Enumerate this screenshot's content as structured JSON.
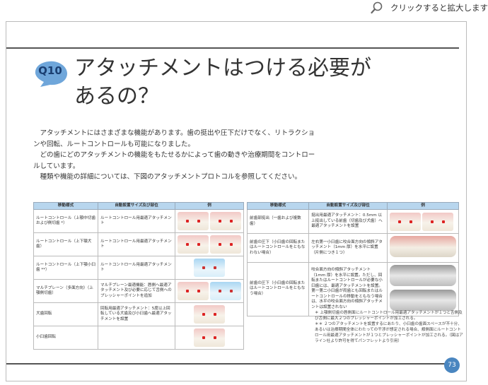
{
  "topbar": {
    "zoom_label": "クリックすると拡大します",
    "icon": "magnifier-icon"
  },
  "header": {
    "badge": "Q10",
    "badge_color": "#6fa6da",
    "title_line1": "アタッチメントはつける必要が",
    "title_line2": "あるの？"
  },
  "body": {
    "p1": "アタッチメントにはさまざまな機能があります。歯の挺出や圧下だけでなく、リトラクションや回転、ルートコントロールも可能になりました。",
    "p2": "どの歯にどのアタッチメントの機能をもたせるかによって歯の動きや治療期間をコントロールしています。",
    "p3": "種類や機能の詳細については、下図のアタッチメントプロトコルを参照してください。"
  },
  "table_left": {
    "headers": [
      "移動様式",
      "自動設置サイズ及び部位",
      "例"
    ],
    "rows": [
      {
        "mode": "ルートコントロール（上顎中切歯および側切歯 *）",
        "size": "ルートコントロール用最適アタッチメント"
      },
      {
        "mode": "ルートコントロール（上下顎犬歯）",
        "size": "ルートコントロール用最適アタッチメント"
      },
      {
        "mode": "ルートコントロール（上下顎小臼歯 **）",
        "size": "ルートコントロール用最適アタッチメント"
      },
      {
        "mode": "マルチプレーン（多面方向）（上顎側切歯）",
        "size": "マルチプレーン最適機能：唇側へ最適アタッチメント及び必要に応じて舌側へのプレッシャーポイントを追加"
      },
      {
        "mode": "犬歯回転",
        "size": "回転用最適アタッチメント：5度以上回転している犬歯及び小臼歯へ最適アタッチメントを設置"
      },
      {
        "mode": "小臼歯回転",
        "size": ""
      }
    ]
  },
  "table_right": {
    "headers": [
      "移動様式",
      "自動設置サイズ及び部位",
      "例"
    ],
    "rows": [
      {
        "mode": "前歯部挺出（一歯および複数歯）",
        "size": "挺出用最適アタッチメント：0.5mm 以上挺出している前歯（切歯及び犬歯）へ最適アタッチメントを設置"
      },
      {
        "mode": "前歯の圧下（小臼歯の回転またはルートコントロールをともなわない場合）",
        "size": "左右第一小臼歯に咬合面方向の傾斜アタッチメント（1mm 厚）を水平に設置（片側につき１つ）"
      },
      {
        "mode": "前歯の圧下（小臼歯の回転またはルートコントロールをともなう場合）",
        "size": "咬合面方向の傾斜アタッチメント（1mm 厚）を水平に設置。ただし、回転またはルートコントロールが必要な小臼歯には、最適アタッチメントを設置。第一第二小臼歯が両歯とも回転またはルートコントロールの移動をともなう場合は、水平の咬合面方向の傾斜アタッチメントは設置されない"
      }
    ]
  },
  "notes": {
    "n1": "＊ 上顎側切歯の唇側面にルートコントロール用最適アタッチメントが１つと舌側及び舌側に最大２つのプレッシャーポイントが加工される。",
    "n2": "＊＊ ２つのアタッチメントを設置するにあたり、小臼歯の歯面スペースが不十分、あるいは治療期間全体にわたっての干渉が想定される場合、頬側面にルートコントロール用最適アタッチメントが１つとプレッシャーポイントが加工される。（図はアライン社より許可を得てパンフレットより引用）"
  },
  "page_number": "73",
  "colors": {
    "header_blue": "#b8d6ee",
    "page_badge": "#4a86c0"
  }
}
